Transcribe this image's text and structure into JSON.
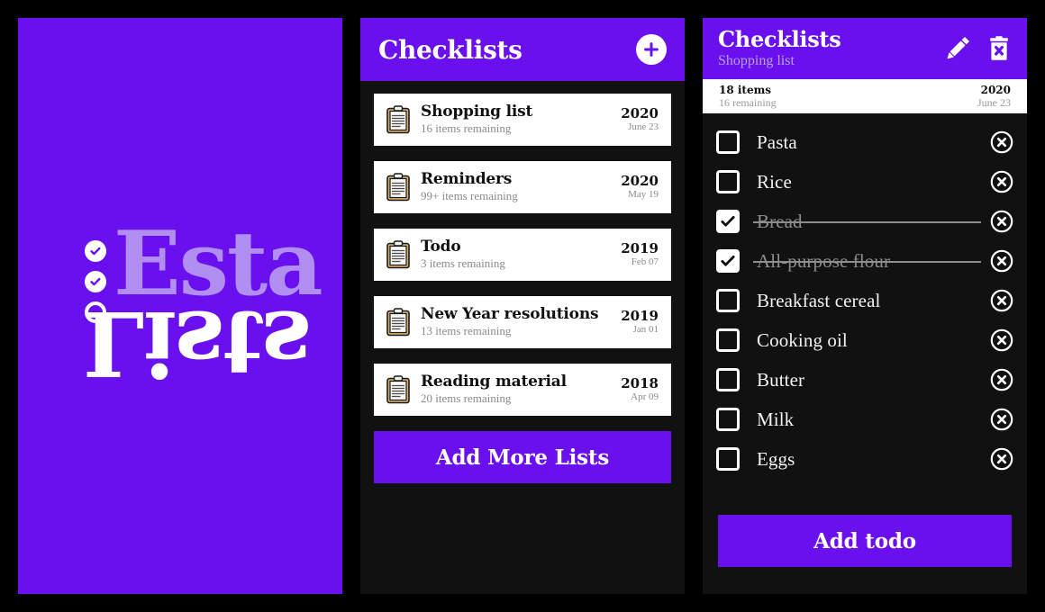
{
  "theme": {
    "brand_purple": "#6a10ee",
    "logo_light_purple": "#b18ef2",
    "panel_dark": "#111111",
    "page_background": "#000000",
    "card_white": "#ffffff",
    "muted_grey": "#8a8a8a"
  },
  "splash": {
    "word_top": "Esta",
    "word_bottom": "Lists",
    "bullets": [
      {
        "icon": "check-circle-filled-icon",
        "state": "checked"
      },
      {
        "icon": "check-circle-filled-icon",
        "state": "checked"
      },
      {
        "icon": "circle-outline-icon",
        "state": "unchecked"
      }
    ]
  },
  "lists_panel": {
    "header": {
      "title": "Checklists",
      "add_icon": "plus-icon"
    },
    "item_icon": "clipboard-icon",
    "items": [
      {
        "name": "Shopping list",
        "remaining": "16 items remaining",
        "year": "2020",
        "date": "June 23"
      },
      {
        "name": "Reminders",
        "remaining": "99+ items remaining",
        "year": "2020",
        "date": "May 19"
      },
      {
        "name": "Todo",
        "remaining": "3 items remaining",
        "year": "2019",
        "date": "Feb 07"
      },
      {
        "name": "New Year resolutions",
        "remaining": "13 items remaining",
        "year": "2019",
        "date": "Jan 01"
      },
      {
        "name": "Reading material",
        "remaining": "20 items remaining",
        "year": "2018",
        "date": "Apr 09"
      }
    ],
    "add_more_label": "Add More Lists"
  },
  "detail_panel": {
    "header": {
      "title": "Checklists",
      "subtitle": "Shopping list",
      "edit_icon": "pencil-icon",
      "delete_icon": "trash-x-icon"
    },
    "stats": {
      "total": "18 items",
      "remaining": "16 remaining",
      "year": "2020",
      "date": "June 23"
    },
    "delete_item_icon": "circle-x-icon",
    "todos": [
      {
        "label": "Pasta",
        "done": false
      },
      {
        "label": "Rice",
        "done": false
      },
      {
        "label": "Bread",
        "done": true
      },
      {
        "label": "All-purpose flour",
        "done": true
      },
      {
        "label": "Breakfast cereal",
        "done": false
      },
      {
        "label": "Cooking oil",
        "done": false
      },
      {
        "label": "Butter",
        "done": false
      },
      {
        "label": "Milk",
        "done": false
      },
      {
        "label": "Eggs",
        "done": false
      }
    ],
    "add_todo_label": "Add todo"
  }
}
